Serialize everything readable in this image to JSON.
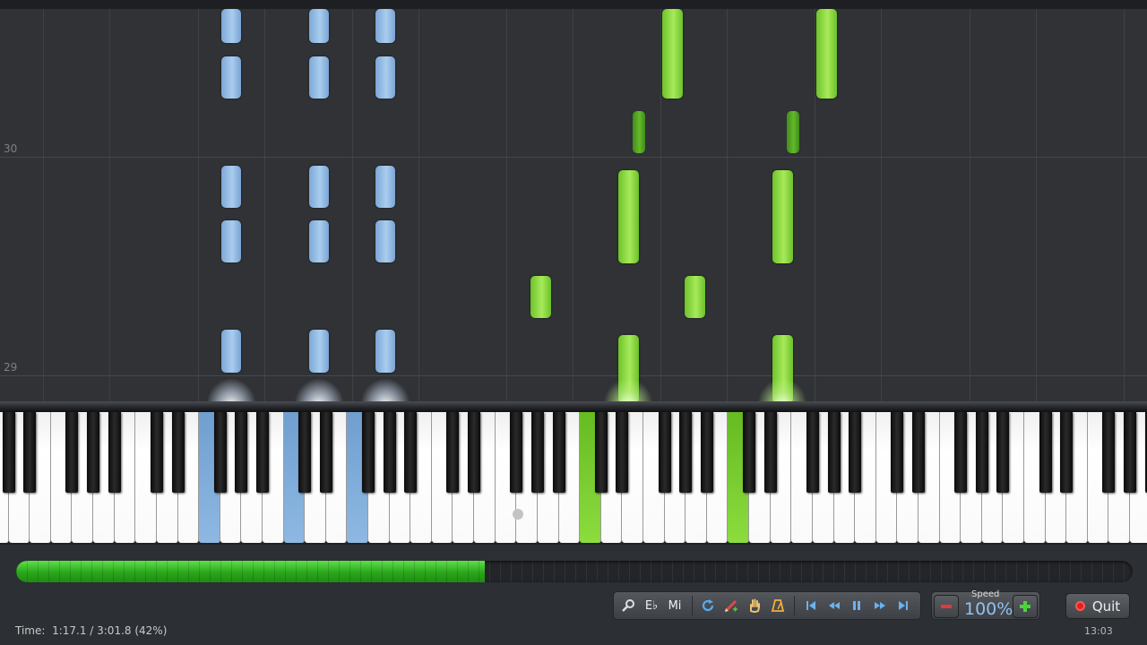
{
  "roll": {
    "measures": [
      {
        "label": "30"
      },
      {
        "label": "29"
      }
    ]
  },
  "transport": {
    "time_label": "Time:",
    "time_value": "1:17.1 / 3:01.8 (42%)",
    "progress": 0.42,
    "key_label": "E♭",
    "notation_label": "Mi"
  },
  "speed": {
    "label": "Speed",
    "value": "100%"
  },
  "quit_label": "Quit",
  "clock": "13:03",
  "icons": {
    "zoom": "magnifier-icon",
    "loop": "loop-icon",
    "marker": "pencil-icon",
    "hand": "hand-icon",
    "metronome": "metronome-icon",
    "skip_start": "skip-to-start-icon",
    "rewind": "rewind-icon",
    "pause": "pause-icon",
    "fast_forward": "fast-forward-icon",
    "skip_end": "skip-to-end-icon",
    "minus": "minus-icon",
    "plus": "plus-icon",
    "quit": "quit-icon"
  },
  "colors": {
    "left_hand": "#8eb8e2",
    "right_hand": "#8cdc3e",
    "progress": "#30b020",
    "speed": "#8fc2f0",
    "quit_icon": "#dd2222"
  }
}
